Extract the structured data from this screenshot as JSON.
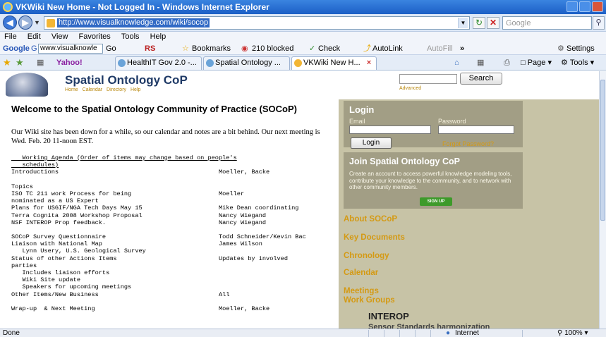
{
  "window": {
    "title": "VKWiki New Home - Not Logged In - Windows Internet Explorer"
  },
  "address": {
    "url": "http://www.visualknowledge.com/wiki/socop",
    "search_placeholder": "Google"
  },
  "menu": [
    "File",
    "Edit",
    "View",
    "Favorites",
    "Tools",
    "Help"
  ],
  "google_toolbar": {
    "label": "Google",
    "input_value": "www.visualknowle",
    "go": "Go",
    "rs": "RS",
    "bookmarks": "Bookmarks",
    "blocked": "210 blocked",
    "check": "Check",
    "autolink": "AutoLink",
    "autofill": "AutoFill",
    "more": "»",
    "settings": "Settings"
  },
  "tabs": {
    "yahoo": "Yahoo!",
    "items": [
      "HealthIT Gov 2.0 -...",
      "Spatial Ontology ...",
      "VKWiki New H..."
    ],
    "close": "×",
    "page_menu": "Page",
    "tools_menu": "Tools"
  },
  "site": {
    "title": "Spatial Ontology CoP",
    "nav": [
      "Home",
      "Calendar",
      "Directory",
      "Help"
    ],
    "search_button": "Search",
    "advanced": "Advanced"
  },
  "main": {
    "heading": "Welcome to the Spatial Ontology Community of Practice (SOCoP)",
    "intro": "Our Wiki site has been down for a while, so our calendar and notes are a bit behind. Our next meeting is Wed. Feb. 20 11-noon EST.",
    "agenda": [
      {
        "a": "   Working Agenda (Order of items may change based on people's",
        "b": "",
        "u": true
      },
      {
        "a": "   schedules)",
        "b": "",
        "u": true
      },
      {
        "a": "Introductions",
        "b": "Moeller, Backe"
      },
      {
        "a": "",
        "b": ""
      },
      {
        "a": "Topics",
        "b": ""
      },
      {
        "a": "ISO TC 211 work Process for being",
        "b": "Moeller"
      },
      {
        "a": "nominated as a US Expert",
        "b": ""
      },
      {
        "a": "Plans for USGIF/NGA Tech Days May 15",
        "b": "Mike Dean coordinating"
      },
      {
        "a": "Terra Cognita 2008 Workshop Proposal",
        "b": "Nancy Wiegand"
      },
      {
        "a": "NSF INTEROP Prop feedback.",
        "b": "Nancy Wiegand"
      },
      {
        "a": "",
        "b": ""
      },
      {
        "a": "SOCoP Survey Questionnaire",
        "b": "Todd Schneider/Kevin Bac"
      },
      {
        "a": "Liaison with National Map",
        "b": "James Wilson"
      },
      {
        "a": "   Lynn Usery, U.S. Geological Survey",
        "b": ""
      },
      {
        "a": "Status of other Actions Items",
        "b": "Updates by involved"
      },
      {
        "a": "parties",
        "b": ""
      },
      {
        "a": "   Includes liaison efforts",
        "b": ""
      },
      {
        "a": "   Wiki Site update",
        "b": ""
      },
      {
        "a": "   Speakers for upcoming meetings",
        "b": ""
      },
      {
        "a": "Other Items/New Business",
        "b": "All"
      },
      {
        "a": "",
        "b": ""
      },
      {
        "a": "Wrap-up  & Next Meeting",
        "b": "Moeller, Backe"
      }
    ]
  },
  "sidebar": {
    "login": {
      "heading": "Login",
      "email": "Email",
      "password": "Password",
      "button": "Login",
      "forgot": "Forgot Password?"
    },
    "join": {
      "heading": "Join Spatial Ontology CoP",
      "text": "Create an account to access powerful knowledge modeling tools, contribute your knowledge to the community, and to network with other community members.",
      "signup": "SIGN UP"
    },
    "links": [
      "About SOCoP",
      "Key Documents",
      "Chronology",
      "Calendar",
      "Meetings",
      "Work Groups"
    ],
    "interop": "INTEROP",
    "interop_sub": "Sensor Standards harmonization"
  },
  "status": {
    "left": "Done",
    "zone": "Internet",
    "zoom": "100%"
  }
}
